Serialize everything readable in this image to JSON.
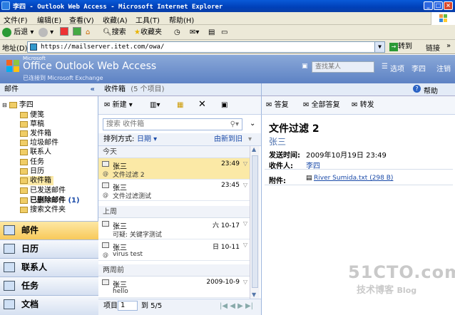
{
  "window": {
    "title": "李四 - Outlook Web Access - Microsoft Internet Explorer",
    "min": "_",
    "max": "□",
    "close": "×"
  },
  "menubar": [
    "文件(F)",
    "编辑(E)",
    "查看(V)",
    "收藏(A)",
    "工具(T)",
    "帮助(H)"
  ],
  "toolbar": {
    "back": "后退",
    "search": "搜索",
    "favorites": "收藏夹"
  },
  "address": {
    "label": "地址(D)",
    "url": "https://mailserver.itet.com/owa/",
    "go": "转到",
    "links": "链接"
  },
  "owa": {
    "brand_small": "Microsoft",
    "brand": "Office Outlook Web Access",
    "sub": "已连接到 Microsoft Exchange",
    "find_people_placeholder": "查找某人",
    "options": "选项",
    "user": "李四",
    "logoff": "注销",
    "help": "帮助"
  },
  "nav": {
    "header": "邮件",
    "root": "李四",
    "folders": [
      "便笺",
      "草稿",
      "发件箱",
      "垃圾邮件",
      "联系人",
      "任务",
      "日历",
      "收件箱",
      "已发送邮件",
      "已删除邮件",
      "搜索文件夹"
    ],
    "deleted_count": "(1)",
    "big_buttons": [
      "邮件",
      "日历",
      "联系人",
      "任务",
      "文档"
    ]
  },
  "list": {
    "folder": "收件箱",
    "count": "(5 个项目)",
    "new_label": "新建",
    "search_placeholder": "搜索 收件箱",
    "sort_label": "排列方式:",
    "sort_field": "日期",
    "sort_order": "由新到旧",
    "groups": [
      {
        "name": "今天",
        "messages": [
          {
            "from": "张三",
            "subject": "文件过滤 2",
            "date": "23:49",
            "selected": true
          },
          {
            "from": "张三",
            "subject": "文件过滤测试",
            "date": "23:45",
            "selected": false
          }
        ]
      },
      {
        "name": "上周",
        "messages": [
          {
            "from": "张三",
            "subject": "可疑: 关键字测试",
            "date": "六 10-17",
            "selected": false
          },
          {
            "from": "张三",
            "subject": "virus test",
            "date": "日 10-11",
            "selected": false
          }
        ]
      },
      {
        "name": "两周前",
        "messages": [
          {
            "from": "张三",
            "subject": "hello",
            "date": "2009-10-9",
            "selected": false
          }
        ]
      }
    ],
    "pager_label": "项目",
    "page_value": "1",
    "page_total": "到 5/5"
  },
  "reading": {
    "reply": "答复",
    "reply_all": "全部答复",
    "forward": "转发",
    "subject": "文件过滤 2",
    "sender": "张三",
    "sent_label": "发送时间:",
    "sent_value": "2009年10月19日 23:49",
    "to_label": "收件人:",
    "to_value": "李四",
    "att_label": "附件:",
    "att_value": "River Sumida.txt (298 B)"
  },
  "watermark": {
    "big": "51CTO.com",
    "small": "技术博客",
    "blog": "Blog"
  }
}
